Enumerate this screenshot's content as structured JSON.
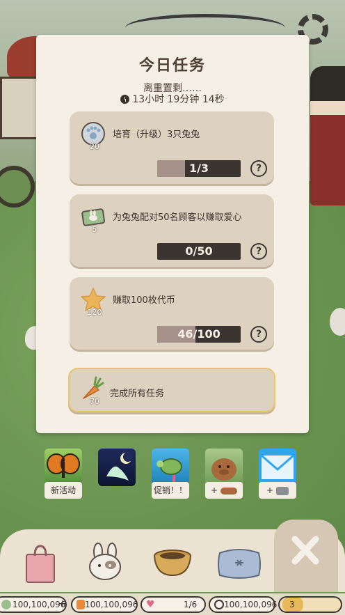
{
  "panel": {
    "title": "今日任务",
    "subtitle": "离重置剩……",
    "timer": "13小时 19分钟 14秒"
  },
  "tasks": [
    {
      "label": "培育（升级）3只兔兔",
      "reward": "20",
      "icon": "paw-coin-icon",
      "progress_text": "1/3",
      "progress": 0.333
    },
    {
      "label": "为兔兔配对50名顾客以赚取爱心",
      "reward": "5",
      "icon": "rabbit-ticket-icon",
      "progress_text": "0/50",
      "progress": 0.0
    },
    {
      "label": "赚取100枚代币",
      "reward": "120",
      "icon": "star-icon",
      "progress_text": "46/100",
      "progress": 0.46
    }
  ],
  "complete_all": {
    "label": "完成所有任务",
    "reward": "70",
    "icon": "carrot-icon"
  },
  "events": [
    {
      "name": "butterfly",
      "caption": "新活动"
    },
    {
      "name": "luna-moth",
      "caption": ""
    },
    {
      "name": "sea-turtle",
      "caption": "促销！！"
    },
    {
      "name": "capybara",
      "caption": "+"
    },
    {
      "name": "mail",
      "caption": "+"
    }
  ],
  "currency": {
    "coins": "100,100,096",
    "carrots": "100,100,096",
    "hearts": "1/6",
    "tokens": "100,100,096",
    "level": "3"
  },
  "colors": {
    "panel_bg": "#f5efe6",
    "card_bg": "#ddd1c0",
    "progress_bg": "#3b3430",
    "progress_fill": "#a6918b",
    "complete_border": "#e8c46a"
  }
}
